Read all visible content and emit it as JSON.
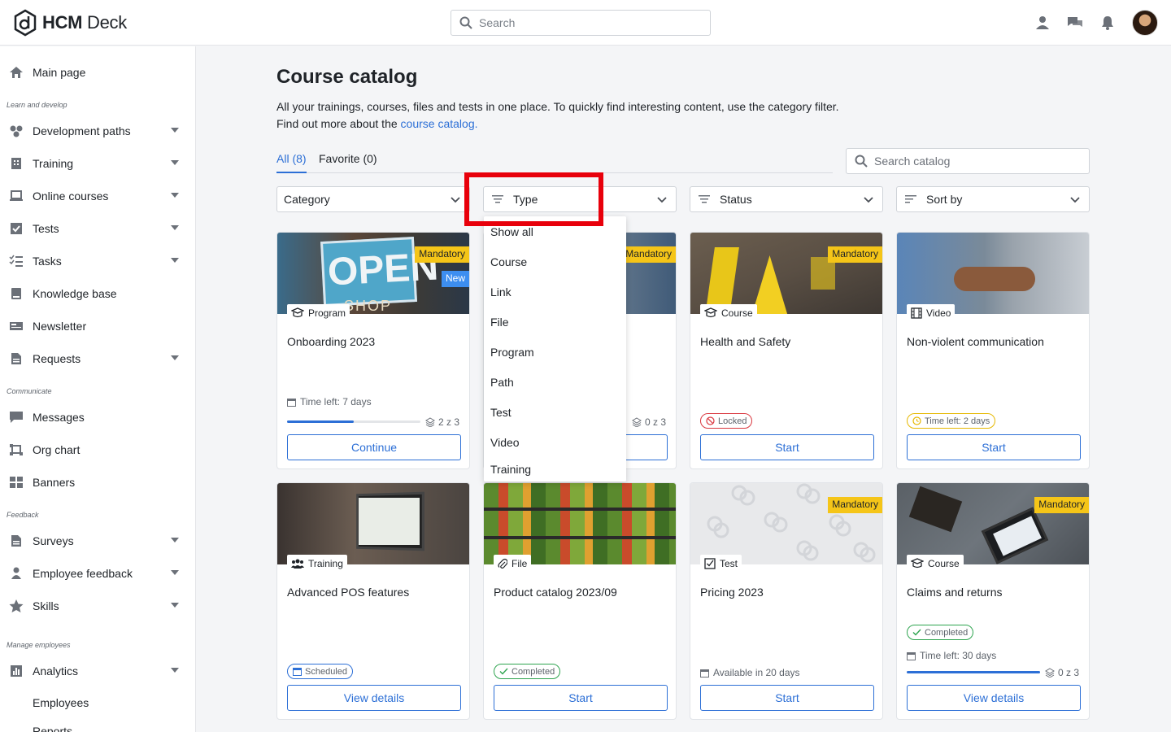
{
  "app": {
    "name_bold": "HCM",
    "name_rest": " Deck",
    "search_placeholder": "Search"
  },
  "sidebar": {
    "items": [
      {
        "label": "Main page",
        "icon": "home-icon",
        "caret": false
      },
      {
        "label": "Development paths",
        "icon": "paths-icon",
        "caret": true
      },
      {
        "label": "Training",
        "icon": "training-icon",
        "caret": true
      },
      {
        "label": "Online courses",
        "icon": "laptop-icon",
        "caret": true
      },
      {
        "label": "Tests",
        "icon": "checkbox-icon",
        "caret": true
      },
      {
        "label": "Tasks",
        "icon": "tasks-icon",
        "caret": true
      },
      {
        "label": "Knowledge base",
        "icon": "book-icon",
        "caret": false
      },
      {
        "label": "Newsletter",
        "icon": "newsletter-icon",
        "caret": false
      },
      {
        "label": "Requests",
        "icon": "document-icon",
        "caret": true
      },
      {
        "label": "Messages",
        "icon": "chat-icon",
        "caret": false
      },
      {
        "label": "Org chart",
        "icon": "org-chart-icon",
        "caret": false
      },
      {
        "label": "Banners",
        "icon": "banners-icon",
        "caret": false
      },
      {
        "label": "Surveys",
        "icon": "survey-icon",
        "caret": true
      },
      {
        "label": "Employee feedback",
        "icon": "feedback-icon",
        "caret": true
      },
      {
        "label": "Skills",
        "icon": "star-icon",
        "caret": true
      },
      {
        "label": "Analytics",
        "icon": "analytics-icon",
        "caret": true
      },
      {
        "label": "Employees",
        "icon": "",
        "caret": false
      },
      {
        "label": "Reports",
        "icon": "",
        "caret": false
      }
    ],
    "sections": [
      "Learn and develop",
      "Communicate",
      "Feedback",
      "Manage employees"
    ]
  },
  "page": {
    "title": "Course catalog",
    "intro_line1": "All your trainings, courses, files and tests in one place. To quickly find interesting content, use the category filter.",
    "intro_line2_prefix": "Find out more about the ",
    "intro_link": "course catalog.",
    "tabs": [
      "All (8)",
      "Favorite (0)"
    ],
    "catalog_search_placeholder": "Search catalog"
  },
  "filters": {
    "category": "Category",
    "type": "Type",
    "status": "Status",
    "sort": "Sort by"
  },
  "type_dropdown": [
    "Show all",
    "Course",
    "Link",
    "File",
    "Program",
    "Path",
    "Test",
    "Video",
    "Training"
  ],
  "cards": [
    {
      "title": "Onboarding 2023",
      "type": "Program",
      "mandatory": "Mandatory",
      "new": "New",
      "time": "Time left: 7 days",
      "progress": 0.5,
      "count": "2 z 3",
      "button": "Continue"
    },
    {
      "title": "",
      "type": "",
      "mandatory": "Mandatory",
      "count": "0 z 3",
      "button": ""
    },
    {
      "title": "Health and Safety",
      "type": "Course",
      "mandatory": "Mandatory",
      "status": "Locked",
      "button": "Start"
    },
    {
      "title": "Non-violent communication",
      "type": "Video",
      "status": "Time left: 2 days",
      "button": "Start"
    },
    {
      "title": "Advanced POS features",
      "type": "Training",
      "status": "Scheduled",
      "button": "View details"
    },
    {
      "title": "Product catalog 2023/09",
      "type": "File",
      "status": "Completed",
      "button": "Start"
    },
    {
      "title": "Pricing 2023",
      "type": "Test",
      "mandatory": "Mandatory",
      "time": "Available in 20 days",
      "button": "Start"
    },
    {
      "title": "Claims and returns",
      "type": "Course",
      "mandatory": "Mandatory",
      "status": "Completed",
      "time": "Time left: 30 days",
      "progress": 1.0,
      "count": "0 z 3",
      "button": "View details"
    }
  ]
}
